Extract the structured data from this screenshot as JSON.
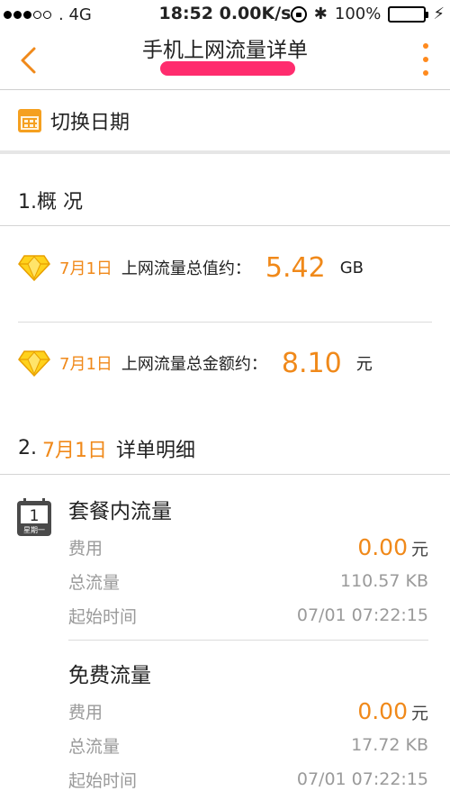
{
  "status_bar": {
    "carrier": ". 4G",
    "time_speed": "18:52 0.00K/s",
    "bluetooth_glyph": "✱",
    "battery": "100%",
    "charge_glyph": "⚡",
    "battery_color": "#4cd964"
  },
  "header": {
    "title": "手机上网流量详单",
    "back_icon": "chevron-left-icon",
    "more_icon": "vertical-dots-icon"
  },
  "date_switch": {
    "label": "切换日期"
  },
  "overview": {
    "heading": "1.概 况",
    "rows": [
      {
        "date": "7月1日",
        "label": "上网流量总值约：",
        "value": "5.42",
        "unit": "GB"
      },
      {
        "date": "7月1日",
        "label": "上网流量总金额约：",
        "value": "8.10",
        "unit": "元"
      }
    ]
  },
  "detail": {
    "heading_prefix": "2.",
    "heading_date": "7月1日",
    "heading_suffix": "详单明细",
    "calendar_day": "1",
    "calendar_weekday": "星期一",
    "items": [
      {
        "name": "套餐内流量",
        "fee_label": "费用",
        "fee_value": "0.00",
        "fee_unit": "元",
        "traffic_label": "总流量",
        "traffic_value": "110.57 KB",
        "start_label": "起始时间",
        "start_value": "07/01 07:22:15"
      },
      {
        "name": "免费流量",
        "fee_label": "费用",
        "fee_value": "0.00",
        "fee_unit": "元",
        "traffic_label": "总流量",
        "traffic_value": "17.72 KB",
        "start_label": "起始时间",
        "start_value": "07/01 07:22:15"
      }
    ]
  },
  "colors": {
    "accent": "#f0891a",
    "redaction": "#ff2c6e"
  }
}
